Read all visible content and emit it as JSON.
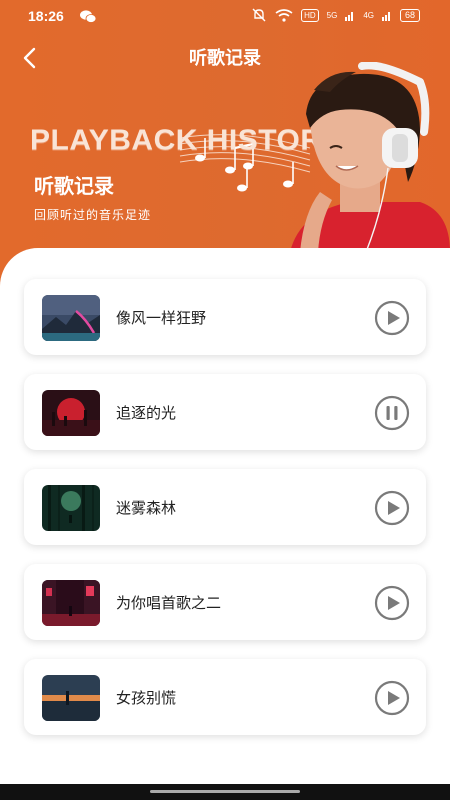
{
  "status": {
    "time": "18:26",
    "hd": "HD",
    "net1": "5G",
    "net2": "4G",
    "battery": "68"
  },
  "header": {
    "title": "听歌记录"
  },
  "banner": {
    "english": "PLAYBACK HISTORY",
    "title": "听歌记录",
    "subtitle": "回顾听过的音乐足迹"
  },
  "songs": [
    {
      "title": "像风一样狂野",
      "state": "play"
    },
    {
      "title": "追逐的光",
      "state": "pause"
    },
    {
      "title": "迷雾森林",
      "state": "play"
    },
    {
      "title": "为你唱首歌之二",
      "state": "play"
    },
    {
      "title": "女孩别慌",
      "state": "play"
    }
  ],
  "colors": {
    "accent": "#e26a2c",
    "control_gray": "#7a7a7a"
  }
}
